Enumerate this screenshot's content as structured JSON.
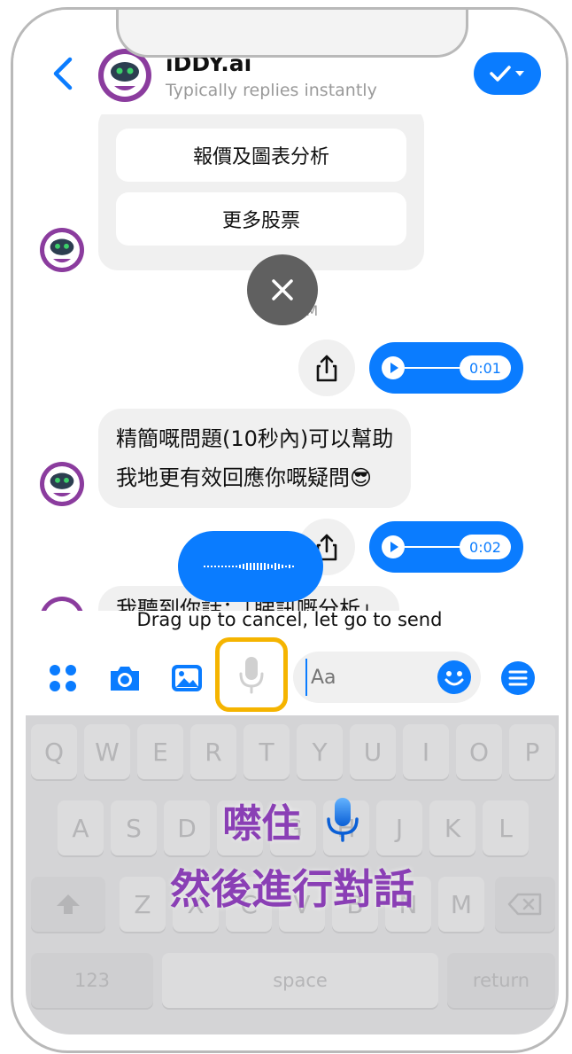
{
  "colors": {
    "accent": "#0a7cff",
    "highlight": "#f5b400",
    "overlay_text": "#8a3fb5"
  },
  "header": {
    "name": "iDDY.ai",
    "subtitle": "Typically replies instantly",
    "back_icon": "chevron-left-icon",
    "check_icon": "check-dropdown-icon"
  },
  "card": {
    "buttons": [
      "報價及圖表分析",
      "更多股票"
    ]
  },
  "timestamp": "4:03 PM",
  "messages": {
    "voice1_duration": "0:01",
    "bot_text_line1": "精簡嘅問題(10秒內)可以幫助",
    "bot_text_line2": "我地更有效回應你嘅疑問😎",
    "voice2_duration": "0:02",
    "bot_text_partial": "我聽到你話：「睇訊嘅分析」"
  },
  "hint": "Drag up to cancel, let go to send",
  "composer": {
    "placeholder": "Aa",
    "icons": [
      "apps-icon",
      "camera-icon",
      "image-icon",
      "mic-icon",
      "emoji-icon",
      "menu-icon"
    ]
  },
  "keyboard": {
    "row1": [
      "Q",
      "W",
      "E",
      "R",
      "T",
      "Y",
      "U",
      "I",
      "O",
      "P"
    ],
    "row2": [
      "A",
      "S",
      "D",
      "F",
      "G",
      "H",
      "J",
      "K",
      "L"
    ],
    "row3": [
      "Z",
      "X",
      "C",
      "V",
      "B",
      "N",
      "M"
    ],
    "num_label": "123",
    "space_label": "space",
    "return_label": "return"
  },
  "overlay": {
    "line1": "噤住",
    "line2": "然後進行對話"
  }
}
